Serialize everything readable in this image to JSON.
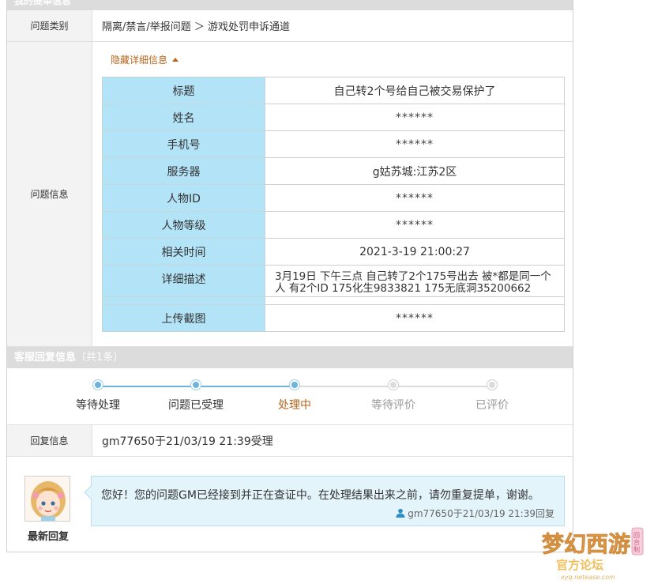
{
  "header": {
    "title": "我的提单信息"
  },
  "category": {
    "label": "问题类别",
    "value": "隔离/禁言/举报问题 ＞ 游戏处罚申诉通道"
  },
  "info": {
    "label": "问题信息",
    "toggle_label": "隐藏详细信息",
    "fields": {
      "title": {
        "key": "标题",
        "value": "自己转2个号给自己被交易保护了"
      },
      "name": {
        "key": "姓名",
        "value": "******"
      },
      "phone": {
        "key": "手机号",
        "value": "******"
      },
      "server": {
        "key": "服务器",
        "value": "g姑苏城:江苏2区"
      },
      "char_id": {
        "key": "人物ID",
        "value": "******"
      },
      "level": {
        "key": "人物等级",
        "value": "******"
      },
      "time": {
        "key": "相关时间",
        "value": "2021-3-19 21:00:27"
      },
      "desc": {
        "key": "详细描述",
        "value": "3月19日 下午三点 自己转了2个175号出去 被*都是同一个人 有2个ID 175化生9833821 175无底洞35200662"
      },
      "screenshot": {
        "key": "上传截图",
        "value": "******"
      }
    }
  },
  "reply_section": {
    "title": "客服回复信息",
    "count": "（共1条）"
  },
  "progress": {
    "steps": [
      {
        "label": "等待处理",
        "state": "done"
      },
      {
        "label": "问题已受理",
        "state": "done"
      },
      {
        "label": "处理中",
        "state": "current"
      },
      {
        "label": "等待评价",
        "state": "pending"
      },
      {
        "label": "已评价",
        "state": "pending"
      }
    ],
    "colors": {
      "done": "#6cb4db",
      "current_text": "#b5651d",
      "pending": "#dcdcdc"
    }
  },
  "reply_info": {
    "label": "回复信息",
    "value": "gm77650于21/03/19 21:39受理"
  },
  "latest": {
    "label": "最新回复",
    "message": "您好！您的问题GM已经接到并正在查证中。在处理结果出来之前，请勿重复提单，谢谢。",
    "meta": "gm77650于21/03/19 21:39回复"
  },
  "watermark": {
    "brand": "梦幻西游",
    "sub": "官方论坛",
    "url": "xyq.netease.com",
    "badge": "回合制"
  }
}
